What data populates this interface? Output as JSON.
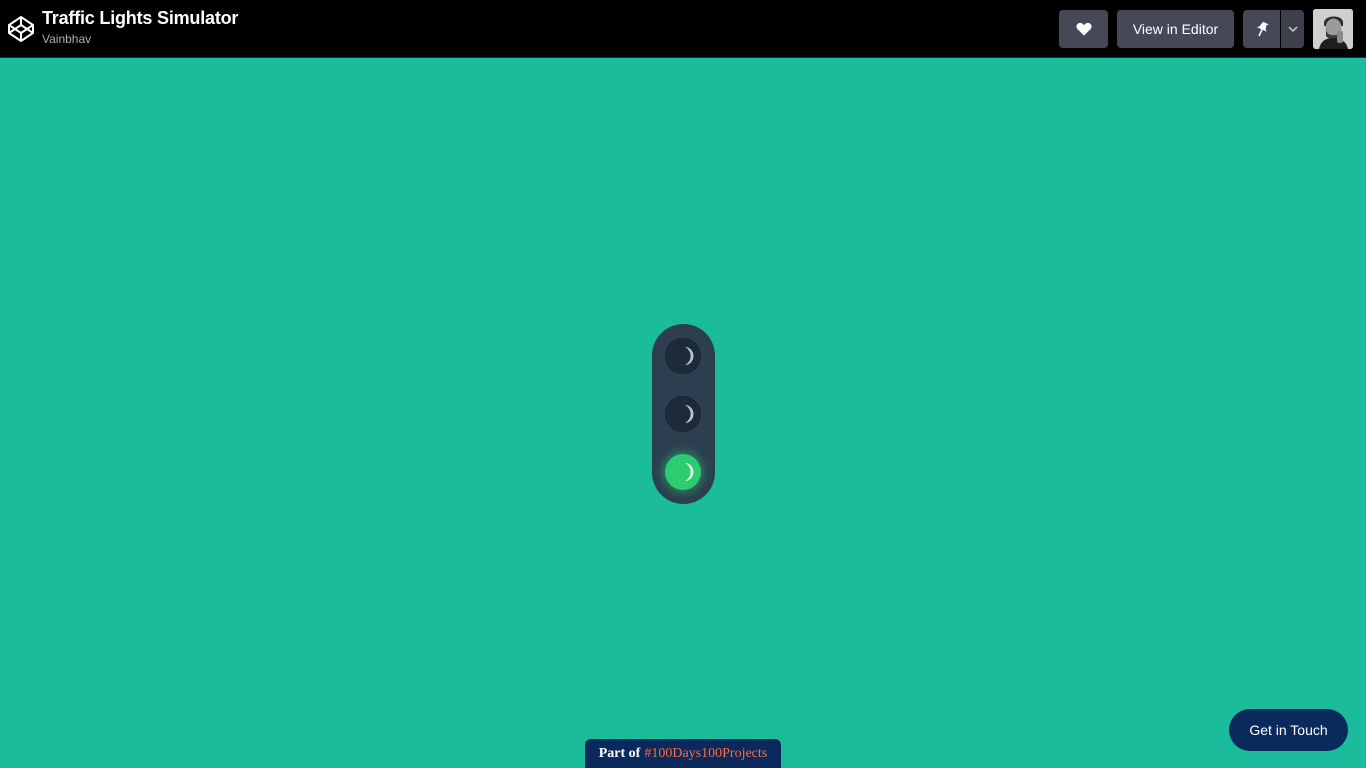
{
  "header": {
    "title": "Traffic Lights Simulator",
    "author": "Vainbhav",
    "logo_icon": "codepen-logo-icon",
    "heart_icon": "heart-icon",
    "editor_label": "View in Editor",
    "pin_icon": "pin-icon",
    "caret_icon": "chevron-down-icon",
    "avatar_icon": "user-avatar"
  },
  "traffic_light": {
    "lamps": [
      {
        "color": "red",
        "state": "off"
      },
      {
        "color": "yellow",
        "state": "off"
      },
      {
        "color": "green",
        "state": "on"
      }
    ],
    "active_color": "#2ecc71",
    "off_color": "#1f2a38",
    "housing_color": "#2c3e50"
  },
  "badge": {
    "prefix": "Part of",
    "tag": "#100Days100Projects"
  },
  "cta": {
    "label": "Get in Touch"
  },
  "colors": {
    "background": "#1abc9c",
    "topbar": "#000000",
    "button": "#444857",
    "navy": "#0a2a5e",
    "accent": "#ff6b3d"
  }
}
